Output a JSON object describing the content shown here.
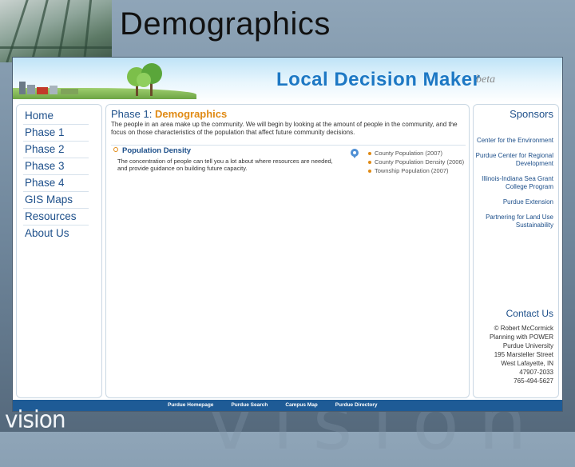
{
  "slide": {
    "title": "Demographics",
    "logo_text": "vision",
    "watermark_text": "vision"
  },
  "app": {
    "title": "Local Decision Maker",
    "beta": "beta",
    "colors": {
      "primary": "#1d4f8a",
      "accent": "#e08a14",
      "footer": "#1e5b96"
    }
  },
  "nav": {
    "items": [
      "Home",
      "Phase 1",
      "Phase 2",
      "Phase 3",
      "Phase 4",
      "GIS Maps",
      "Resources",
      "About Us"
    ]
  },
  "main": {
    "heading_prefix": "Phase 1:",
    "heading_accent": "Demographics",
    "intro": "The people in an area make up the community. We will begin by looking at the amount of people in the community, and the focus on those characteristics of the population that affect future community decisions.",
    "section_title": "Population Density",
    "section_text": "The concentration of people can tell you a lot about where resources are needed, and provide guidance on building future capacity.",
    "layers": [
      "County Population (2007)",
      "County Population Density (2006)",
      "Township Population (2007)"
    ]
  },
  "sidebar": {
    "sponsors_title": "Sponsors",
    "sponsors": [
      "Center for the Environment",
      "Purdue Center for Regional Development",
      "Illinois-Indiana Sea Grant College Program",
      "Purdue Extension",
      "Partnering for Land Use Sustainability"
    ],
    "contact_title": "Contact Us",
    "contact_lines": [
      "© Robert McCormick",
      "Planning with POWER",
      "Purdue University",
      "195 Marsteller Street",
      "West Lafayette, IN",
      "47907-2033",
      "765-494-5627"
    ]
  },
  "footer": {
    "links": [
      "Purdue Homepage",
      "Purdue Search",
      "Campus Map",
      "Purdue Directory"
    ]
  }
}
